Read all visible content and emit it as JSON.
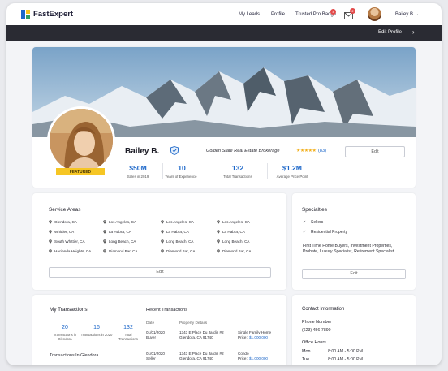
{
  "brand": {
    "name": "FastExpert",
    "logo_colors": [
      "#1b66c9",
      "#f4c21c",
      "#2f9e63"
    ]
  },
  "nav": {
    "links": [
      "My Leads",
      "Profile",
      "Trusted Pro Badge"
    ],
    "trusted_badge_count": "4",
    "messages_count": "2",
    "user_name": "Bailey B."
  },
  "editbar": {
    "label": "Edit Profile"
  },
  "profile": {
    "name": "Bailey B.",
    "featured_label": "FEATURED",
    "brokerage": "Golden State Real Estate Brokerage",
    "rating_stars": "★★★★★",
    "review_count": "(83)",
    "edit_label": "Edit",
    "stats": [
      {
        "value": "$50M",
        "label": "Sales in 2019"
      },
      {
        "value": "10",
        "label": "Years of Experience"
      },
      {
        "value": "132",
        "label": "Total Transactions"
      },
      {
        "value": "$1.2M",
        "label": "Average Price Point"
      }
    ]
  },
  "service_areas": {
    "title": "Service Areas",
    "columns": [
      [
        "Glendora, CA",
        "Whittier, CA",
        "South Whittier, CA",
        "Hacienda Heights, CA"
      ],
      [
        "Los Angeles, CA",
        "La Habra, CA",
        "Long Beach, CA",
        "Diamond Bar, CA"
      ],
      [
        "Los Angeles, CA",
        "La Habra, CA",
        "Long Beach, CA",
        "Diamond Bar, CA"
      ],
      [
        "Los Angeles, CA",
        "La Habra, CA",
        "Long Beach, CA",
        "Diamond Bar, CA"
      ]
    ],
    "edit_label": "Edit"
  },
  "specialties": {
    "title": "Specialties",
    "items": [
      "Sellers",
      "Residential Property"
    ],
    "text": "First Time Home Buyers, Investment Properties, Probate, Luxury Specialist, Retirement Specialist",
    "edit_label": "Edit"
  },
  "transactions": {
    "title": "My Transactions",
    "stats": [
      {
        "value": "20",
        "label": "Transactions in Glendora"
      },
      {
        "value": "16",
        "label": "Transactions in 2020"
      },
      {
        "value": "132",
        "label": "Total Transactions"
      }
    ],
    "in_city_label": "Transactions In Glendora",
    "recent_title": "Recent Transactions",
    "headers": [
      "Date",
      "Property Details"
    ],
    "rows": [
      {
        "date": "01/01/2020",
        "role": "Buyer",
        "address1": "1343 E Place Du Jardin #2",
        "address2": "Glendora, CA 91740",
        "type": "Single Family Home",
        "price_label": "Price:",
        "price": "$1,000,000"
      },
      {
        "date": "01/01/2020",
        "role": "Seller",
        "address1": "1343 E Place Du Jardin #2",
        "address2": "Glendora, CA 91740",
        "type": "Condo",
        "price_label": "Price:",
        "price": "$1,000,000"
      }
    ]
  },
  "contact": {
    "title": "Contact Information",
    "phone_label": "Phone Number",
    "phone": "(623) 456-7890",
    "hours_label": "Office Hours",
    "hours": [
      {
        "day": "Mon",
        "time": "8:00 AM - 5:00 PM"
      },
      {
        "day": "Tue",
        "time": "8:00 AM - 5:00 PM"
      }
    ]
  }
}
